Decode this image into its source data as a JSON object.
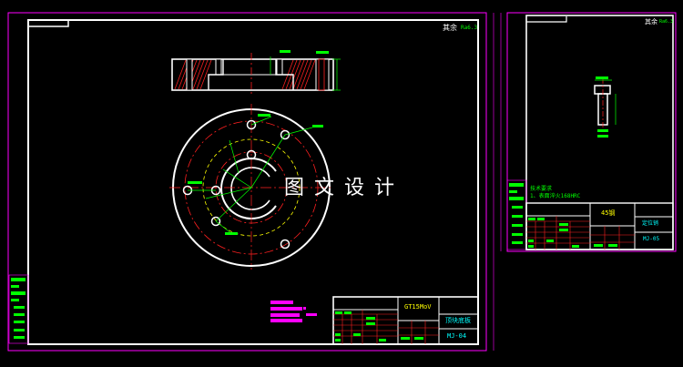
{
  "sheet1": {
    "roughness": "其余",
    "roughness_value": "Ra6.3",
    "material": "GT15MoV",
    "part_name": "顶块底板",
    "drawing_no": "MJ-04"
  },
  "sheet2": {
    "roughness": "其余",
    "roughness_value": "Ra6.3",
    "tech_req_title": "技术要求",
    "tech_req_item": "1、表面淬火168HRC",
    "material": "45钢",
    "part_name": "定位销",
    "drawing_no": "MJ-05"
  },
  "watermark": "图文设计",
  "colors": {
    "background": "#000000",
    "frame": "#ff00ff",
    "border": "#ffffff",
    "red": "#ff2020",
    "yellow": "#ffff00",
    "green": "#00ff00",
    "cyan": "#00ffff",
    "magenta_block": "#ff00ff"
  }
}
